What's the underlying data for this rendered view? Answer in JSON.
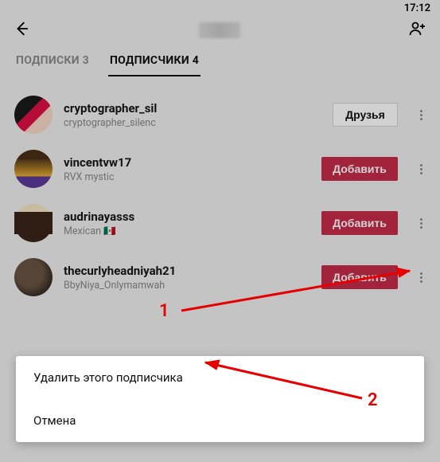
{
  "status": {
    "time": "17:12"
  },
  "tabs": {
    "subscriptions": {
      "label": "ПОДПИСКИ",
      "count": "3"
    },
    "followers": {
      "label": "ПОДПИСЧИКИ",
      "count": "4"
    }
  },
  "followers": [
    {
      "username": "cryptographer_sil",
      "subtitle": "cryptographer_silenc",
      "button_type": "friends",
      "button_label": "Друзья"
    },
    {
      "username": "vincentvw17",
      "subtitle": "RVX mystic",
      "button_type": "add",
      "button_label": "Добавить"
    },
    {
      "username": "audrinayasss",
      "subtitle": "Mexican 🇲🇽",
      "button_type": "add",
      "button_label": "Добавить"
    },
    {
      "username": "thecurlyheadniyah21",
      "subtitle": "BbyNiya_Onlymamwah",
      "button_type": "add",
      "button_label": "Добавить"
    }
  ],
  "sheet": {
    "remove": "Удалить этого подписчика",
    "cancel": "Отмена"
  },
  "annotations": {
    "one": "1",
    "two": "2"
  }
}
